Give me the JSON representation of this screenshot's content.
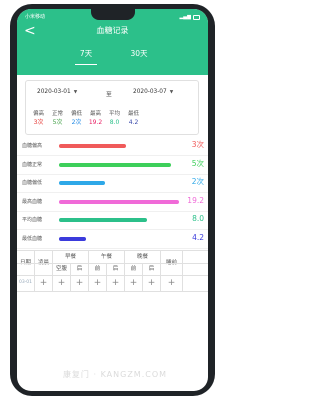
{
  "status": {
    "carrier": "小米移动",
    "battery": "▮"
  },
  "nav": {
    "back_icon": "back-arrow-icon",
    "back_glyph": "<",
    "title": "血糖记录"
  },
  "tabs": [
    {
      "label": "7天",
      "active": true
    },
    {
      "label": "30天",
      "active": false
    }
  ],
  "range": {
    "from": "2020-03-01",
    "separator": "至",
    "to": "2020-03-07",
    "caret": "▼"
  },
  "stats": [
    {
      "label": "偏高",
      "value": "3次",
      "color": "#e53935"
    },
    {
      "label": "正常",
      "value": "5次",
      "color": "#43a047"
    },
    {
      "label": "偏低",
      "value": "2次",
      "color": "#1e88e5"
    },
    {
      "label": "最高",
      "value": "19.2",
      "color": "#e91e63"
    },
    {
      "label": "平均",
      "value": "8.0",
      "color": "#2cc08a"
    },
    {
      "label": "最低",
      "value": "4.2",
      "color": "#3949ab"
    }
  ],
  "bars": [
    {
      "label": "血糖偏高",
      "value": "3次",
      "fill": 0.55,
      "color": "#f05a5a"
    },
    {
      "label": "血糖正常",
      "value": "5次",
      "fill": 0.92,
      "color": "#3dcf5a"
    },
    {
      "label": "血糖偏低",
      "value": "2次",
      "fill": 0.38,
      "color": "#2ea8e8"
    },
    {
      "label": "最高血糖",
      "value": "19.2",
      "fill": 0.98,
      "color": "#f06ad8"
    },
    {
      "label": "平均血糖",
      "value": "8.0",
      "fill": 0.72,
      "color": "#2cc08a"
    },
    {
      "label": "最低血糖",
      "value": "4.2",
      "fill": 0.22,
      "color": "#3b3bdc"
    }
  ],
  "table": {
    "date_header": "日期",
    "dawn_header": "凌晨",
    "meals": [
      {
        "name": "早餐",
        "subs": [
          "空腹",
          "后"
        ]
      },
      {
        "name": "午餐",
        "subs": [
          "前",
          "后"
        ]
      },
      {
        "name": "晚餐",
        "subs": [
          "前",
          "后"
        ]
      }
    ],
    "bedtime_header": "睡前",
    "row": {
      "date": "03-01",
      "plus": "+"
    }
  },
  "watermark": "康复门 · KANGZM.COM"
}
